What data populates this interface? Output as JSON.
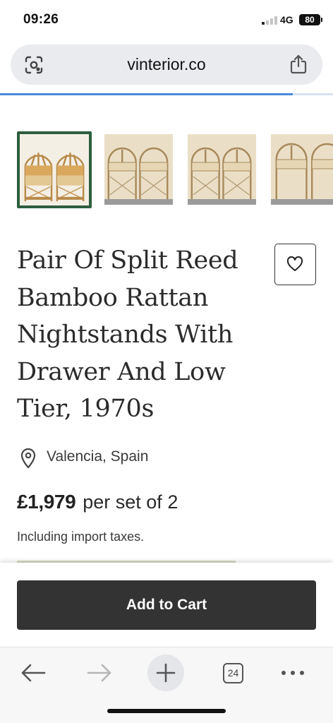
{
  "status_bar": {
    "time": "09:26",
    "network": "4G",
    "battery": "80",
    "signal_bars_active": 1,
    "signal_bars_total": 4
  },
  "browser": {
    "url": "vinterior.co",
    "load_progress": 0.88,
    "tab_count": "24",
    "icons": [
      "lens-icon",
      "share-icon",
      "back-icon",
      "forward-icon",
      "new-tab-icon",
      "tab-switcher-icon",
      "more-icon"
    ]
  },
  "gallery": {
    "thumbnail_count": 4,
    "selected_index": 0
  },
  "product": {
    "title": "Pair Of Split Reed Bamboo Rattan Nightstands With Drawer And Low Tier, 1970s",
    "location": "Valencia, Spain",
    "price": "£1,979",
    "price_unit": "per set of 2",
    "tax_note": "Including import taxes.",
    "add_to_cart_label": "Add to Cart"
  },
  "colors": {
    "selected_thumb_border": "#2e5e3f",
    "cart_button": "#333333",
    "progress": "#4a8ad8"
  }
}
